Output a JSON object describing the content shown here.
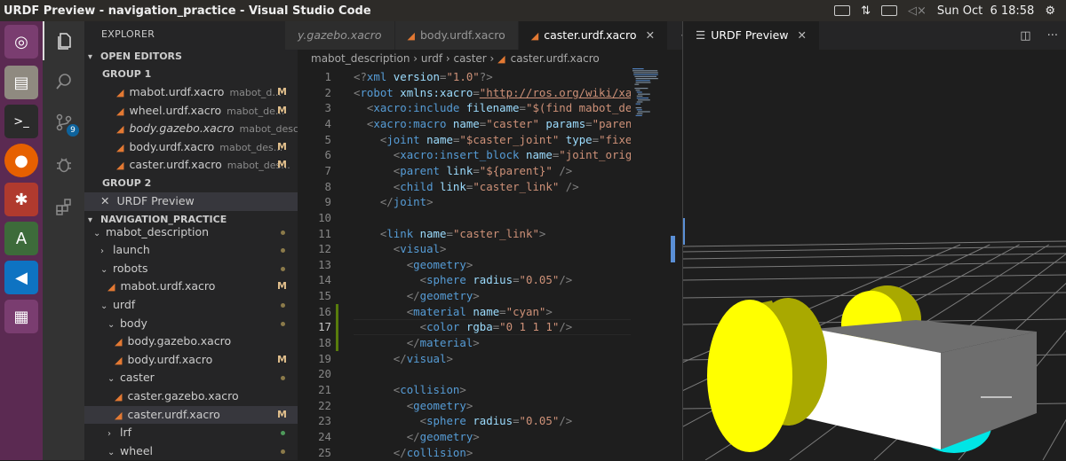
{
  "topbar": {
    "title": "URDF Preview - navigation_practice - Visual Studio Code",
    "datetime": "Sun Oct  6 18:58"
  },
  "sidebar": {
    "title": "EXPLORER",
    "open_editors_label": "OPEN EDITORS",
    "group1_label": "GROUP 1",
    "group1": [
      {
        "name": "mabot.urdf.xacro",
        "desc": "mabot_d...",
        "status": "M",
        "italic": false
      },
      {
        "name": "wheel.urdf.xacro",
        "desc": "mabot_de...",
        "status": "M",
        "italic": false
      },
      {
        "name": "body.gazebo.xacro",
        "desc": "mabot_descri...",
        "status": "",
        "italic": true
      },
      {
        "name": "body.urdf.xacro",
        "desc": "mabot_des...",
        "status": "M",
        "italic": false
      },
      {
        "name": "caster.urdf.xacro",
        "desc": "mabot_des...",
        "status": "M",
        "italic": false
      }
    ],
    "group2_label": "GROUP 2",
    "group2": [
      {
        "name": "URDF Preview"
      }
    ],
    "project_label": "NAVIGATION_PRACTICE",
    "tree": [
      {
        "name": "mabot_description",
        "depth": 0,
        "kind": "folder-open"
      },
      {
        "name": "launch",
        "depth": 1,
        "kind": "folder-closed"
      },
      {
        "name": "robots",
        "depth": 1,
        "kind": "folder-open"
      },
      {
        "name": "mabot.urdf.xacro",
        "depth": 2,
        "kind": "file",
        "status": "M"
      },
      {
        "name": "urdf",
        "depth": 1,
        "kind": "folder-open"
      },
      {
        "name": "body",
        "depth": 2,
        "kind": "folder-open"
      },
      {
        "name": "body.gazebo.xacro",
        "depth": 3,
        "kind": "file"
      },
      {
        "name": "body.urdf.xacro",
        "depth": 3,
        "kind": "file",
        "status": "M"
      },
      {
        "name": "caster",
        "depth": 2,
        "kind": "folder-open"
      },
      {
        "name": "caster.gazebo.xacro",
        "depth": 3,
        "kind": "file"
      },
      {
        "name": "caster.urdf.xacro",
        "depth": 3,
        "kind": "file",
        "status": "M",
        "selected": true
      },
      {
        "name": "lrf",
        "depth": 2,
        "kind": "folder-closed",
        "dot": "green"
      },
      {
        "name": "wheel",
        "depth": 2,
        "kind": "folder-open"
      }
    ]
  },
  "editor": {
    "tabs": [
      {
        "label": "y.gazebo.xacro",
        "active": false
      },
      {
        "label": "body.urdf.xacro",
        "active": false
      },
      {
        "label": "caster.urdf.xacro",
        "active": true
      }
    ],
    "more_label": "···",
    "breadcrumb": [
      "mabot_description",
      "urdf",
      "caster",
      "caster.urdf.xacro"
    ],
    "current_line": 17,
    "lines": [
      "<?xml version=\"1.0\"?>",
      "<robot xmlns:xacro=\"http://ros.org/wiki/xacro\">",
      "  <xacro:include filename=\"$(find mabot_descript",
      "  <xacro:macro name=\"caster\" params=\"parent *joi",
      "    <joint name=\"$caster_joint\" type=\"fixed\">",
      "      <xacro:insert_block name=\"joint_origin\" />",
      "      <parent link=\"${parent}\" />",
      "      <child link=\"caster_link\" />",
      "    </joint>",
      "",
      "    <link name=\"caster_link\">",
      "      <visual>",
      "        <geometry>",
      "          <sphere radius=\"0.05\"/>",
      "        </geometry>",
      "        <material name=\"cyan\">",
      "          <color rgba=\"0 1 1 1\"/>",
      "        </material>",
      "      </visual>",
      "",
      "      <collision>",
      "        <geometry>",
      "          <sphere radius=\"0.05\"/>",
      "        </geometry>",
      "      </collision>"
    ]
  },
  "preview": {
    "tab_label": "URDF Preview",
    "colors": {
      "wheel": "#ffff00",
      "wheel_dark": "#a9a900",
      "body": "#ffffff",
      "body_dark": "#6e6e6e",
      "caster": "#00e5e5",
      "grid": "#7a7a7a"
    }
  }
}
